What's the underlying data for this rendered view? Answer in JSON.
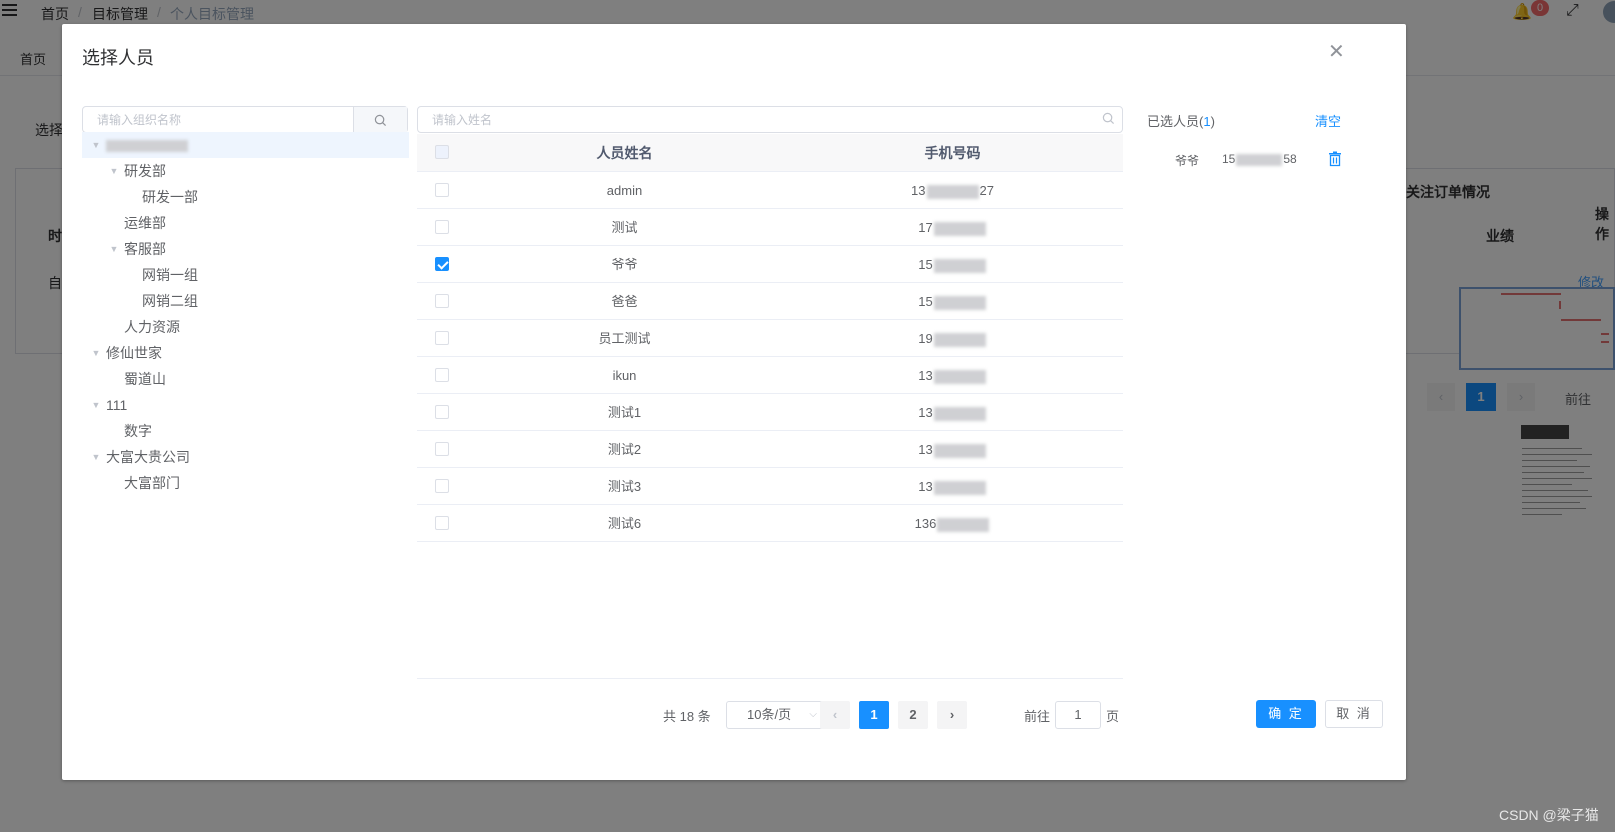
{
  "breadcrumb": [
    "首页",
    "目标管理",
    "个人目标管理"
  ],
  "notifications": "0",
  "tags": {
    "home": "首页"
  },
  "background": {
    "select_label": "选择",
    "col_time": "时",
    "row_value": "自",
    "header_orders": "关注订单情况",
    "header_performance": "业绩",
    "header_ops": "操作",
    "edit_link": "修改",
    "page_current": "1",
    "goto": "前往"
  },
  "dialog": {
    "title": "选择人员",
    "org_search_placeholder": "请输入组织名称",
    "name_search_placeholder": "请输入姓名",
    "tree": [
      {
        "label": "",
        "level": 0,
        "expanded": true,
        "blurred": true
      },
      {
        "label": "研发部",
        "level": 1,
        "expanded": true
      },
      {
        "label": "研发一部",
        "level": 2
      },
      {
        "label": "运维部",
        "level": 1
      },
      {
        "label": "客服部",
        "level": 1,
        "expanded": true
      },
      {
        "label": "网销一组",
        "level": 2
      },
      {
        "label": "网销二组",
        "level": 2
      },
      {
        "label": "人力资源",
        "level": 1
      },
      {
        "label": "修仙世家",
        "level": 0,
        "expanded": true
      },
      {
        "label": "蜀道山",
        "level": 1
      },
      {
        "label": "111",
        "level": 0,
        "expanded": true
      },
      {
        "label": "数字",
        "level": 1
      },
      {
        "label": "大富大贵公司",
        "level": 0,
        "expanded": true
      },
      {
        "label": "大富部门",
        "level": 1
      }
    ],
    "table": {
      "col_name": "人员姓名",
      "col_phone": "手机号码",
      "rows": [
        {
          "name": "admin",
          "phone_start": "13",
          "phone_end": "27",
          "checked": false
        },
        {
          "name": "测试",
          "phone_start": "17",
          "phone_end": "",
          "checked": false
        },
        {
          "name": "爷爷",
          "phone_start": "15",
          "phone_end": "",
          "checked": true
        },
        {
          "name": "爸爸",
          "phone_start": "15",
          "phone_end": "",
          "checked": false
        },
        {
          "name": "员工测试",
          "phone_start": "19",
          "phone_end": "",
          "checked": false
        },
        {
          "name": "ikun",
          "phone_start": "13",
          "phone_end": "",
          "checked": false
        },
        {
          "name": "测试1",
          "phone_start": "13",
          "phone_end": "",
          "checked": false
        },
        {
          "name": "测试2",
          "phone_start": "13",
          "phone_end": "",
          "checked": false
        },
        {
          "name": "测试3",
          "phone_start": "13",
          "phone_end": "",
          "checked": false
        },
        {
          "name": "测试6",
          "phone_start": "136",
          "phone_end": "",
          "checked": false
        }
      ]
    },
    "pagination": {
      "total": "共 18 条",
      "page_size": "10条/页",
      "pages": [
        "1",
        "2"
      ],
      "current": "1",
      "goto_label": "前往",
      "goto_value": "1",
      "page_suffix": "页"
    },
    "selected": {
      "title": "已选人员",
      "count": "1",
      "clear": "清空",
      "items": [
        {
          "name": "爷爷",
          "phone_start": "15",
          "phone_end": "58"
        }
      ]
    },
    "confirm": "确 定",
    "cancel": "取 消"
  },
  "watermark": "CSDN @梁子猫",
  "colors": {
    "primary": "#1890ff",
    "badge": "#f56c6c",
    "overlay": "rgba(0,0,0,0.5)"
  },
  "icons": [
    "menu-icon",
    "bell-icon",
    "fullscreen-icon",
    "search-icon",
    "close-icon",
    "caret-down-icon",
    "chevron-left-icon",
    "chevron-right-icon",
    "delete-icon"
  ]
}
